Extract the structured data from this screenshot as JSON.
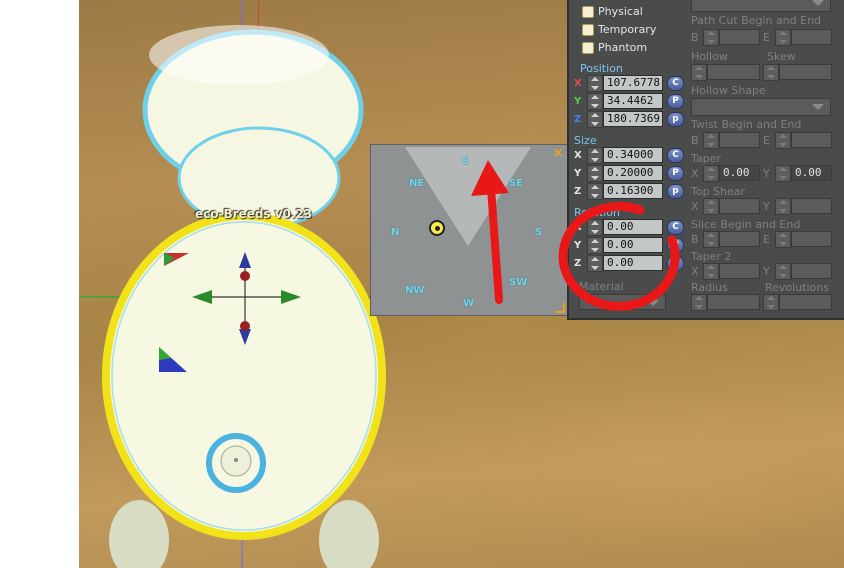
{
  "overhead_label": "eco-Breeds v0.23",
  "compass": {
    "directions": {
      "E": "E",
      "NE": "NE",
      "SE": "SE",
      "N": "N",
      "S": "S",
      "NW": "NW",
      "SW": "SW",
      "W": "W"
    },
    "close_icon": "×",
    "marker_icon": "target-icon"
  },
  "panel": {
    "checkboxes": [
      {
        "label": "Physical",
        "checked": false
      },
      {
        "label": "Temporary",
        "checked": false
      },
      {
        "label": "Phantom",
        "checked": false
      }
    ],
    "position": {
      "title": "Position",
      "axes": [
        {
          "axis": "X",
          "value": "107.6778",
          "btn": "C",
          "color": "#e05050"
        },
        {
          "axis": "Y",
          "value": "34.4462",
          "btn": "P",
          "color": "#50d050"
        },
        {
          "axis": "Z",
          "value": "180.7369",
          "btn": "p",
          "color": "#5080f0"
        }
      ]
    },
    "size": {
      "title": "Size",
      "axes": [
        {
          "axis": "X",
          "value": "0.34000",
          "btn": "C"
        },
        {
          "axis": "Y",
          "value": "0.20000",
          "btn": "P"
        },
        {
          "axis": "Z",
          "value": "0.16300",
          "btn": "p"
        }
      ]
    },
    "rotation": {
      "title": "Rotation",
      "axes": [
        {
          "axis": "X",
          "value": "0.00",
          "btn": "C"
        },
        {
          "axis": "Y",
          "value": "0.00",
          "btn": "P"
        },
        {
          "axis": "Z",
          "value": "0.00",
          "btn": "p"
        }
      ]
    },
    "material_label": "Material",
    "right": {
      "path_cut": "Path Cut Begin and End",
      "b": "B",
      "e": "E",
      "hollow": "Hollow",
      "skew": "Skew",
      "hollow_shape": "Hollow Shape",
      "twist": "Twist Begin and End",
      "taper": "Taper",
      "x": "X",
      "y": "Y",
      "taper_x": "0.00",
      "taper_y": "0.00",
      "top_shear": "Top Shear",
      "slice": "Slice Begin and End",
      "taper2": "Taper 2",
      "radius": "Radius",
      "revolutions": "Revolutions"
    }
  },
  "colors": {
    "annotation_red": "#e81818",
    "panel_bg": "#4a4c4c",
    "accent_blue": "#7fc4f0"
  }
}
